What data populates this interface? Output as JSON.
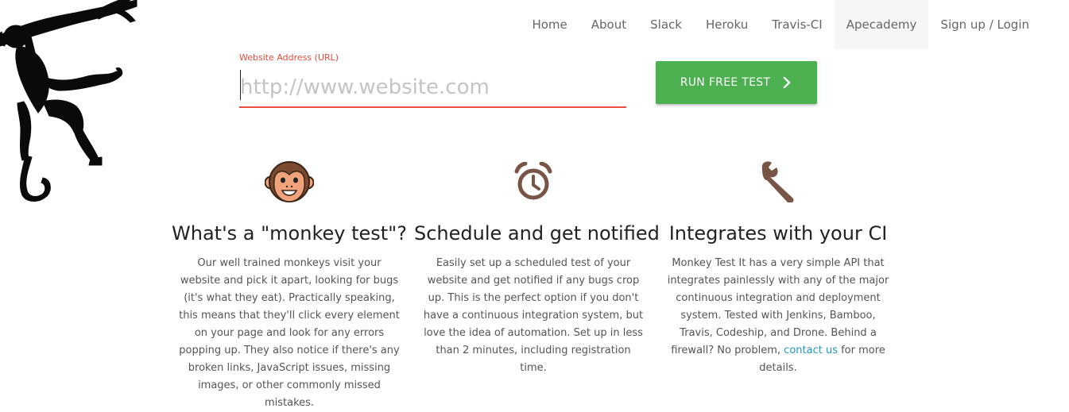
{
  "nav": {
    "items": [
      {
        "label": "Home"
      },
      {
        "label": "About"
      },
      {
        "label": "Slack"
      },
      {
        "label": "Heroku"
      },
      {
        "label": "Travis-CI"
      },
      {
        "label": "Apecademy",
        "active": true
      },
      {
        "label": "Sign up / Login"
      }
    ]
  },
  "url_form": {
    "label": "Website Address (URL)",
    "placeholder": "http://www.website.com",
    "value": ""
  },
  "run_button": {
    "label": "RUN FREE TEST",
    "icon": "chevron-right-icon",
    "color": "#4caf50"
  },
  "colors": {
    "accent_red": "#e74c3c",
    "feature_icon_brown": "#795548",
    "link_blue": "#2196c8"
  },
  "features": [
    {
      "icon": "monkey-face-icon",
      "title": "What's a \"monkey test\"?",
      "text": "Our well trained monkeys visit your website and pick it apart, looking for bugs (it's what they eat). Practically speaking, this means that they'll click every element on your page and look for any errors popping up. They also notice if there's any broken links, JavaScript issues, missing images, or other commonly missed mistakes."
    },
    {
      "icon": "alarm-clock-icon",
      "title": "Schedule and get notified",
      "text": "Easily set up a scheduled test of your website and get notified if any bugs crop up. This is the perfect option if you don't have a continuous integration system, but love the idea of automation. Set up in less than 2 minutes, including registration time."
    },
    {
      "icon": "wrench-icon",
      "title": "Integrates with your CI",
      "text_before": "Monkey Test It has a very simple API that integrates painlessly with any of the major continuous integration and deployment system. Tested with Jenkins, Bamboo, Travis, Codeship, and Drone. Behind a firewall? No problem,",
      "link": "contact us",
      "text_after": "for more details."
    }
  ]
}
